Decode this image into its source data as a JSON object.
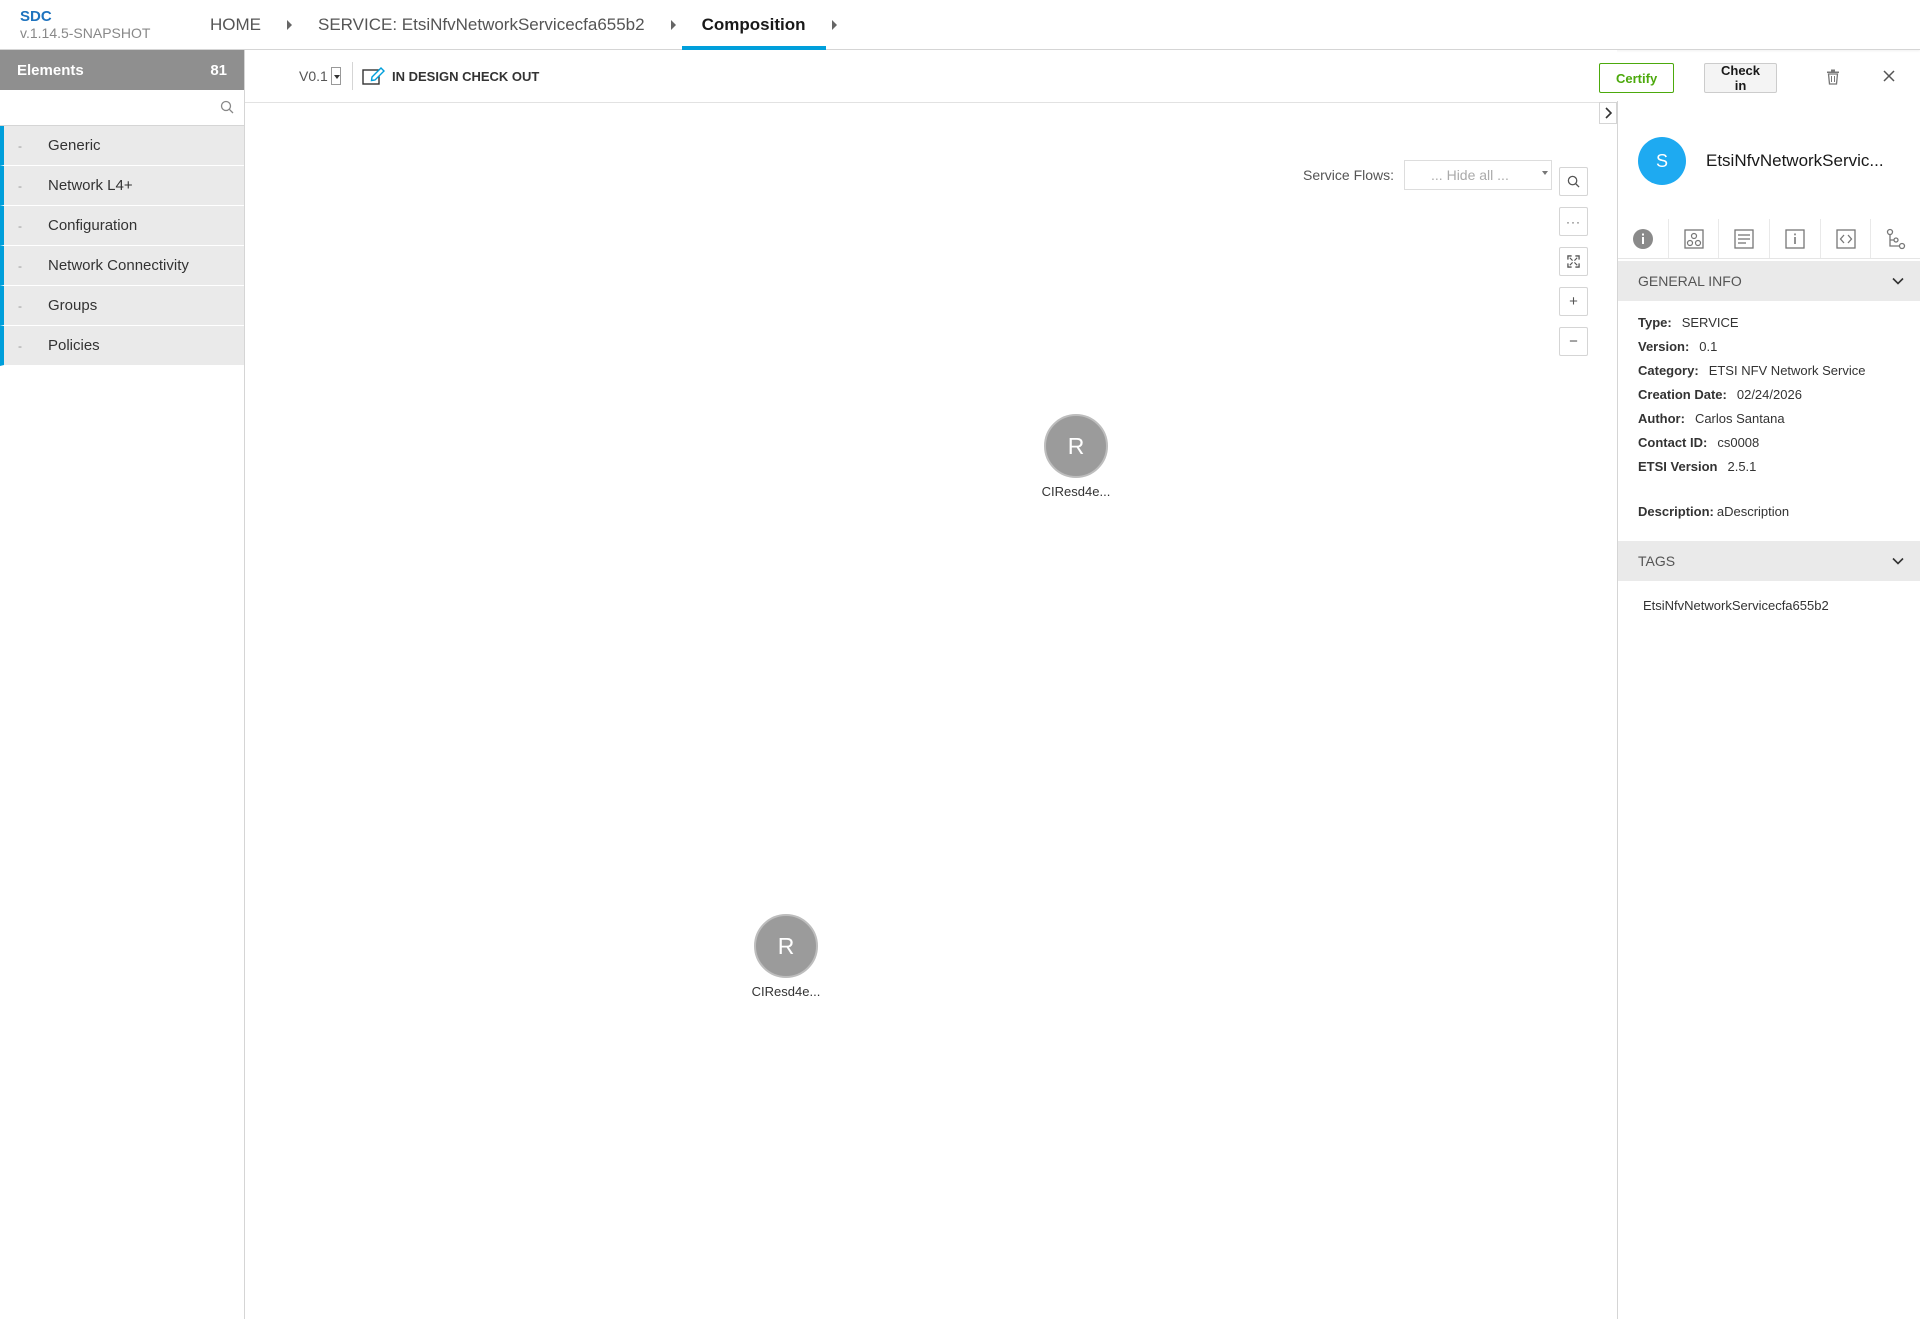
{
  "app": {
    "name": "SDC",
    "version": "v.1.14.5-SNAPSHOT"
  },
  "breadcrumbs": [
    {
      "label": "HOME"
    },
    {
      "label": "SERVICE: EtsiNfvNetworkServicecfa655b2"
    },
    {
      "label": "Composition"
    }
  ],
  "palette": {
    "title": "Elements",
    "count": "81",
    "search_placeholder": "",
    "categories": [
      {
        "label": "Generic"
      },
      {
        "label": "Network L4+"
      },
      {
        "label": "Configuration"
      },
      {
        "label": "Network Connectivity"
      },
      {
        "label": "Groups"
      },
      {
        "label": "Policies"
      }
    ]
  },
  "toolbar": {
    "version": "V0.1",
    "status": "IN DESIGN CHECK OUT",
    "certify_label": "Certify",
    "checkin_label": "Check in"
  },
  "service_flows": {
    "label": "Service Flows:",
    "selected": "... Hide all ..."
  },
  "canvas": {
    "nodes": [
      {
        "initial": "R",
        "label": "CIResd4e..."
      },
      {
        "initial": "R",
        "label": "CIResd4e..."
      }
    ]
  },
  "details": {
    "avatar_letter": "S",
    "title": "EtsiNfvNetworkServic...",
    "general_info_label": "GENERAL INFO",
    "fields": [
      {
        "key": "Type:",
        "value": "SERVICE"
      },
      {
        "key": "Version:",
        "value": "0.1"
      },
      {
        "key": "Category:",
        "value": "ETSI NFV Network Service"
      },
      {
        "key": "Creation Date:",
        "value": "02/24/2026"
      },
      {
        "key": "Author:",
        "value": "Carlos Santana"
      },
      {
        "key": "Contact ID:",
        "value": "cs0008"
      },
      {
        "key": "ETSI Version",
        "value": "2.5.1"
      }
    ],
    "description_key": "Description:",
    "description_value": "aDescription",
    "tags_label": "TAGS",
    "tags": [
      "EtsiNfvNetworkServicecfa655b2"
    ]
  },
  "colors": {
    "accent": "#009fdb",
    "certify": "#4ca90c",
    "avatar": "#1eaaf1",
    "node": "#9b9b9b"
  }
}
